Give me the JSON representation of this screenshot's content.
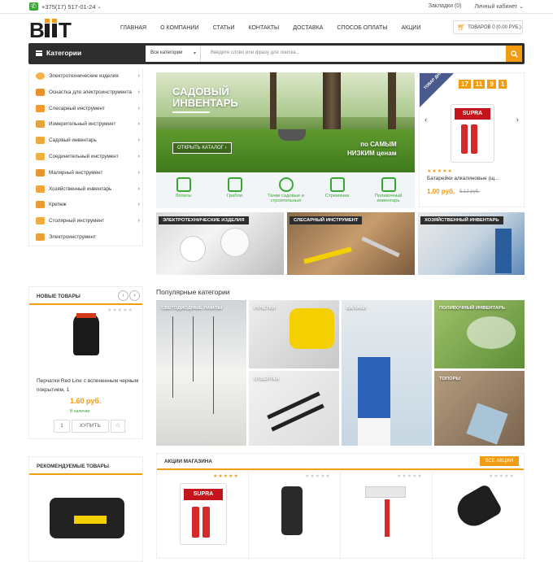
{
  "topbar": {
    "phone": "+375(17) 517-01-24",
    "bookmarks": "Закладки (0)",
    "account": "Личный кабинет"
  },
  "header": {
    "logo": "BIIT",
    "nav": [
      "ГЛАВНАЯ",
      "О КОМПАНИИ",
      "СТАТЬИ",
      "КОНТАКТЫ",
      "ДОСТАВКА",
      "СПОСОБ ОПЛАТЫ",
      "АКЦИИ"
    ],
    "cart": "ТОВАРОВ 0 (0.00 РУБ.)"
  },
  "searchbar": {
    "categories_label": "Категории",
    "select_value": "Все категории",
    "placeholder": "Введите слово или фразу для поиска..."
  },
  "sidebar": {
    "items": [
      {
        "label": "Электротехнические изделия",
        "icon": "bulb-icon"
      },
      {
        "label": "Оснастка для электроинструмента",
        "icon": "drill-bit-icon"
      },
      {
        "label": "Слесарный инструмент",
        "icon": "wrench-icon"
      },
      {
        "label": "Измерительный инструмент",
        "icon": "ruler-icon"
      },
      {
        "label": "Садовый инвентарь",
        "icon": "watering-can-icon"
      },
      {
        "label": "Соединительный инструмент",
        "icon": "stapler-icon"
      },
      {
        "label": "Малярный инструмент",
        "icon": "paint-roller-icon"
      },
      {
        "label": "Хозяйственный инвентарь",
        "icon": "broom-icon"
      },
      {
        "label": "Крепеж",
        "icon": "screw-icon"
      },
      {
        "label": "Столярный инструмент",
        "icon": "saw-icon"
      },
      {
        "label": "Электроинструмент",
        "icon": "power-tool-icon"
      }
    ]
  },
  "banner": {
    "title_1": "САДОВЫЙ",
    "title_2": "ИНВЕНТАРЬ",
    "button": "ОТКРЫТЬ КАТАЛОГ",
    "slogan_1": "по САМЫМ",
    "slogan_2": "НИЗКИМ ценам"
  },
  "tools": [
    {
      "label": "Лопаты"
    },
    {
      "label": "Грабли"
    },
    {
      "label": "Тачки садовые и строительные"
    },
    {
      "label": "Стремянки"
    },
    {
      "label": "Поливочный инвентарь"
    }
  ],
  "deal": {
    "badge": "ТОВАР ДНЯ",
    "timer": [
      "17",
      "11",
      "9",
      "1"
    ],
    "product": "Батарейки алкалиновые (щ...",
    "price": "1.00 руб.",
    "old_price": "5.12 руб."
  },
  "category_tiles": [
    "ЭЛЕКТРОТЕХНИЧЕСКИЕ ИЗДЕЛИЯ",
    "СЛЕСАРНЫЙ ИНСТРУМЕНТ",
    "ХОЗЯЙСТВЕННЫЙ ИНВЕНТАРЬ"
  ],
  "new_products": {
    "title": "НОВЫЕ ТОВАРЫ",
    "product": "Перчатки Red Line с вспененным черным покрытием, 1",
    "price": "1.60 руб.",
    "stock": "В наличии",
    "qty": "1",
    "buy": "КУПИТЬ"
  },
  "popular": {
    "title": "Популярные категории",
    "items": [
      "СВЕТОДИОДНЫЕ ЛАМПЫ",
      "РУЛЕТКИ",
      "ВАЛИКИ",
      "ПОЛИВОЧНЫЙ ИНВЕНТАРЬ",
      "ОТВЕРТКИ",
      "ТОПОРЫ"
    ]
  },
  "recommended": {
    "title": "РЕКОМЕНДУЕМЫЕ ТОВАРЫ"
  },
  "promo": {
    "title": "АКЦИИ МАГАЗИНА",
    "all_button": "ВСЕ АКЦИИ"
  },
  "colors": {
    "accent": "#f29c11",
    "dark": "#2d2d2d",
    "green": "#3aa635"
  }
}
